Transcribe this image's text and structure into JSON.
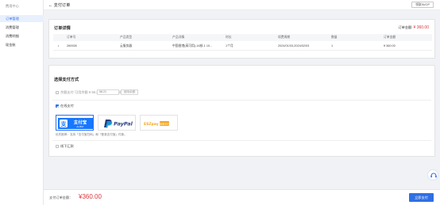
{
  "sidebar": {
    "title": "费用中心",
    "items": [
      {
        "label": "订单管理",
        "active": true
      },
      {
        "label": "消费管理",
        "active": false
      },
      {
        "label": "消费明细",
        "active": false
      },
      {
        "label": "现金账",
        "active": false
      }
    ]
  },
  "header": {
    "back_label": "支付订单",
    "action_label": "领取IN/OP"
  },
  "order": {
    "title": "订单详情",
    "amount_label": "订单金额:",
    "amount_value": "¥ 360.00",
    "columns": [
      "订单号",
      "产品类型",
      "产品详情",
      "时长",
      "续费周期",
      "数量",
      "订单金额"
    ],
    "row": {
      "marker": "•",
      "id": "260928",
      "type": "云服务器",
      "detail": "中国香港(高可用)-16核-1 10...",
      "duration": "1个月",
      "period": "2024/01/03-2024/02/03",
      "qty": "1",
      "amount": "¥ 360.00"
    }
  },
  "payment": {
    "title": "选择支付方式",
    "balance_label": "余额支付     可用余额 ¥ 58.21，再从账户扣除：",
    "balance_input": "58.21",
    "balance_btn": "使用余额",
    "online_label": "在线支付",
    "methods": [
      {
        "name": "alipay",
        "text": "支付宝",
        "subtext": "ALIPAY",
        "selected": true
      },
      {
        "name": "paypal",
        "text": "PayPal",
        "selected": false
      },
      {
        "name": "eszpay",
        "text": "ESZpay",
        "badge": "极速支付",
        "selected": false
      }
    ],
    "hint": "优先推荐：支持「支付宝扫码」和「登录支付宝」付款。",
    "offline_label": "线下汇款"
  },
  "footer": {
    "total_label": "支付订单金额：",
    "total_value": "¥360.00",
    "pay_btn": "立即支付"
  },
  "colors": {
    "accent": "#2f6fe4",
    "price": "#d9363e",
    "alipay": "#1677ff",
    "paypal_dark": "#253b80",
    "paypal_light": "#179bd7",
    "esz": "#f5a623"
  }
}
